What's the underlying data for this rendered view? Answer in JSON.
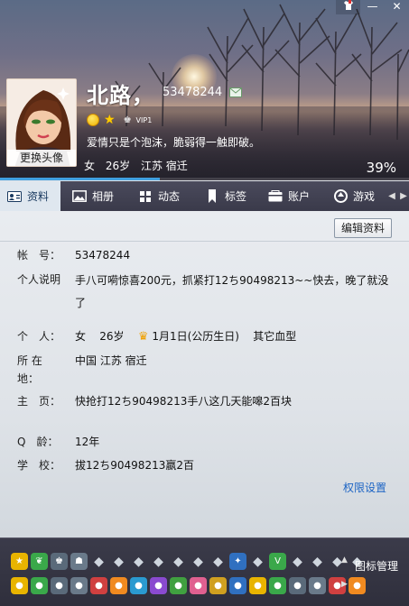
{
  "window": {
    "skin_icon": "shirt-icon",
    "min_label": "—",
    "close_label": "✕"
  },
  "profile": {
    "nickname": "北路，",
    "qq_number": "53478244",
    "vip_label": "VIP1",
    "signature": "爱情只是个泡沫，脆弱得一触即破。",
    "gender": "女",
    "age": "26岁",
    "location": "江苏 宿迁",
    "completion_percent": 39,
    "completion_label": "39%",
    "change_avatar_label": "更换头像"
  },
  "tabs": [
    {
      "label": "资料",
      "icon": "id-card-icon",
      "active": true
    },
    {
      "label": "相册",
      "icon": "photo-icon",
      "active": false
    },
    {
      "label": "动态",
      "icon": "feed-icon",
      "active": false
    },
    {
      "label": "标签",
      "icon": "tag-icon",
      "active": false
    },
    {
      "label": "账户",
      "icon": "wallet-icon",
      "active": false
    },
    {
      "label": "游戏",
      "icon": "game-icon",
      "active": false
    }
  ],
  "content": {
    "edit_label": "编辑资料",
    "rows": [
      {
        "label": "帐　号：",
        "value": "53478244"
      },
      {
        "label": "个人说明",
        "value": "手八可嗬惊喜200元，抓紧打12ち90498213~~快去，晚了就没了"
      },
      {
        "label": "个　人：",
        "value_gender": "女",
        "value_age": "26岁",
        "value_birthday": "1月1日(公历生日)",
        "value_blood": "其它血型"
      },
      {
        "label": "所 在 地：",
        "value": "中国 江苏 宿迁"
      },
      {
        "label": "主　页：",
        "value": "快抢打12ち90498213手八这几天能嗥2百块"
      },
      {
        "label": "Q　龄：",
        "value": "12年"
      },
      {
        "label": "学　校：",
        "value": "拔12ち90498213嬴2百"
      }
    ],
    "permission_link": "权限设置"
  },
  "bottom_bar": {
    "manage_label": "图标管理",
    "row1": [
      "star-icon",
      "leaf-icon",
      "crown-icon",
      "bot-icon",
      "diamond-icon",
      "diamond-icon",
      "diamond-icon",
      "diamond-icon",
      "diamond-icon",
      "diamond-icon",
      "diamond-icon",
      "bird-icon",
      "diamond-icon",
      "vip-icon",
      "diamond-icon",
      "diamond-icon",
      "diamond-icon",
      "diamond-icon"
    ],
    "row2": [
      "qzone-icon",
      "weibo-icon",
      "pet-icon",
      "game-icon",
      "gift-icon",
      "music-icon",
      "map-icon",
      "mail-icon",
      "city-icon",
      "pay-icon",
      "camera-icon",
      "ring-icon",
      "video-icon",
      "app-icon",
      "ai-icon",
      "panda-icon",
      "music-tencent-icon",
      "ghost-icon"
    ]
  },
  "colors": {
    "accent": "#1c64c4",
    "progress": "#40a0e0",
    "tab_bar": "#3a3a4a"
  }
}
